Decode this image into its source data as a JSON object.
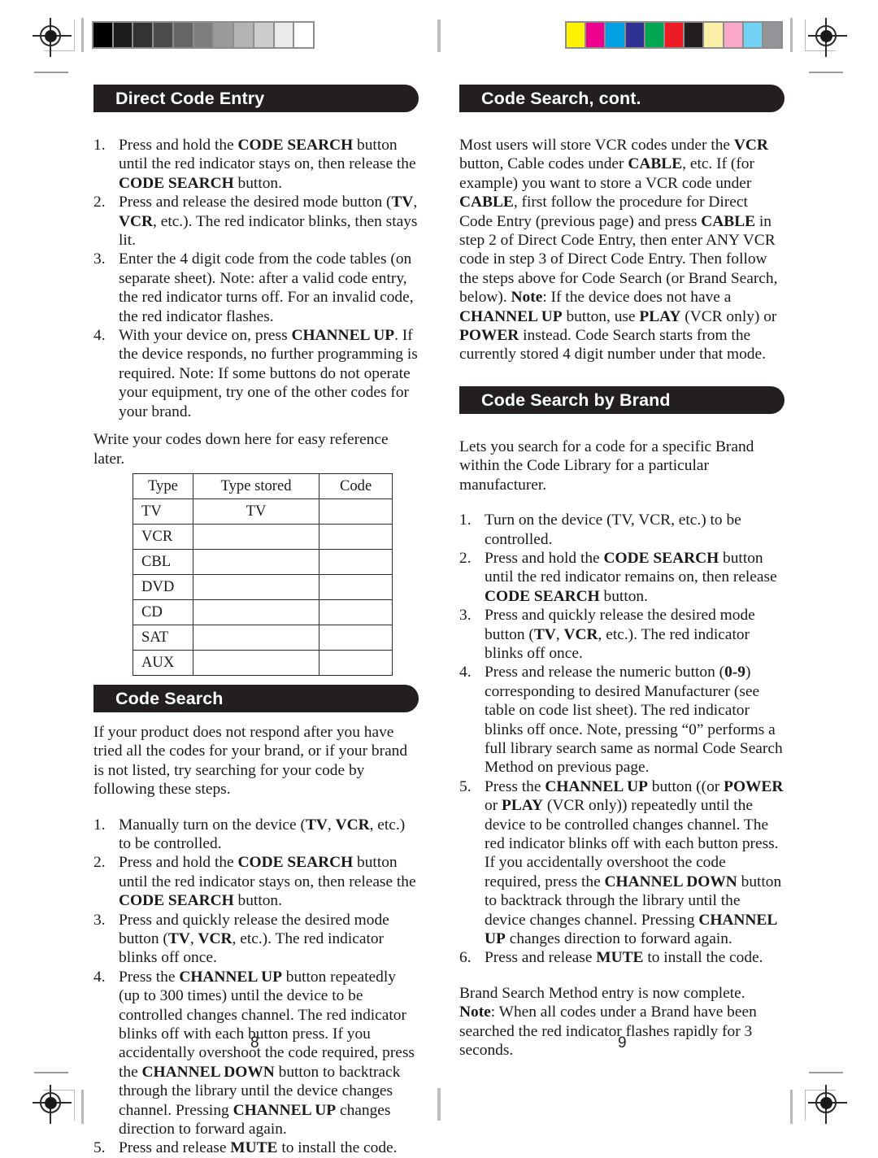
{
  "print_marks": {
    "grayscale_bar": {
      "name": "grayscale-step-wedge",
      "patches": [
        "#000000",
        "#1c1c1c",
        "#333333",
        "#4c4c4c",
        "#656565",
        "#7e7e7e",
        "#9b9b9b",
        "#b5b5b5",
        "#cccccc",
        "#eaeaea",
        "#ffffff"
      ]
    },
    "color_bar": {
      "name": "process-color-bar",
      "patches": [
        "#fff200",
        "#ec008c",
        "#00a0e3",
        "#2e3192",
        "#00a651",
        "#ed1c24",
        "#231f20",
        "#fbf0a8",
        "#f9a8c8",
        "#72d2f4",
        "#939598"
      ]
    }
  },
  "left_page": {
    "page_number": "8",
    "sections": [
      {
        "id": "direct-code-entry",
        "header": "Direct Code Entry",
        "steps": [
          {
            "num": "1.",
            "parts": [
              {
                "t": "Press and hold the "
              },
              {
                "t": "CODE SEARCH",
                "b": true
              },
              {
                "t": " button until the red indicator stays on, then release the "
              },
              {
                "t": "CODE SEARCH",
                "b": true
              },
              {
                "t": " button."
              }
            ]
          },
          {
            "num": "2.",
            "parts": [
              {
                "t": "Press and release the desired mode button ("
              },
              {
                "t": "TV",
                "b": true
              },
              {
                "t": ", "
              },
              {
                "t": "VCR",
                "b": true
              },
              {
                "t": ", etc.). The red indicator blinks, then stays lit."
              }
            ]
          },
          {
            "num": "3.",
            "parts": [
              {
                "t": "Enter the 4 digit code from the code tables (on separate sheet). Note: after a valid code entry, the red indicator turns off.  For an invalid code, the red indicator flashes."
              }
            ]
          },
          {
            "num": "4.",
            "parts": [
              {
                "t": "With your device on, press "
              },
              {
                "t": "CHANNEL UP",
                "b": true
              },
              {
                "t": ". If the device responds, no further programming is required. Note: If some buttons do not operate your equipment, try one of the other codes for your brand."
              }
            ]
          }
        ],
        "table_intro": "Write your codes down here for easy reference later.",
        "table": {
          "headers": [
            "Type",
            "Type  stored",
            "Code"
          ],
          "rows": [
            {
              "type": "TV",
              "stored": "TV",
              "code": ""
            },
            {
              "type": "VCR",
              "stored": "",
              "code": ""
            },
            {
              "type": "CBL",
              "stored": "",
              "code": ""
            },
            {
              "type": "DVD",
              "stored": "",
              "code": ""
            },
            {
              "type": "CD",
              "stored": "",
              "code": ""
            },
            {
              "type": "SAT",
              "stored": "",
              "code": ""
            },
            {
              "type": "AUX",
              "stored": "",
              "code": ""
            }
          ]
        }
      },
      {
        "id": "code-search",
        "header": "Code Search",
        "intro": "If your product does not respond after you have tried all the codes for your brand, or if your brand is not listed, try searching for your code by following these steps.",
        "steps": [
          {
            "num": "1.",
            "parts": [
              {
                "t": "Manually turn on the device ("
              },
              {
                "t": "TV",
                "b": true
              },
              {
                "t": ", "
              },
              {
                "t": "VCR",
                "b": true
              },
              {
                "t": ", etc.) to be controlled."
              }
            ]
          },
          {
            "num": "2.",
            "parts": [
              {
                "t": "Press and hold the "
              },
              {
                "t": "CODE SEARCH",
                "b": true
              },
              {
                "t": " button until the red indicator stays on, then release the "
              },
              {
                "t": "CODE SEARCH",
                "b": true
              },
              {
                "t": " button."
              }
            ]
          },
          {
            "num": "3.",
            "parts": [
              {
                "t": "Press and quickly release the desired mode button ("
              },
              {
                "t": "TV",
                "b": true
              },
              {
                "t": ", "
              },
              {
                "t": "VCR",
                "b": true
              },
              {
                "t": ", etc.). The red indicator blinks off once."
              }
            ]
          },
          {
            "num": "4.",
            "parts": [
              {
                "t": "Press the "
              },
              {
                "t": "CHANNEL UP",
                "b": true
              },
              {
                "t": " button repeatedly (up to 300 times) until the device to be controlled changes channel. The red indicator blinks off with each button press.  If you accidentally overshoot the code required, press the "
              },
              {
                "t": "CHANNEL DOWN",
                "b": true
              },
              {
                "t": " button to backtrack through the library until the device changes channel. Pressing "
              },
              {
                "t": "CHANNEL UP",
                "b": true
              },
              {
                "t": " changes direction to forward again."
              }
            ]
          },
          {
            "num": "5.",
            "parts": [
              {
                "t": "Press and release "
              },
              {
                "t": "MUTE",
                "b": true
              },
              {
                "t": " to install the code."
              }
            ]
          }
        ]
      }
    ]
  },
  "right_page": {
    "page_number": "9",
    "sections": [
      {
        "id": "code-search-cont",
        "header": "Code Search, cont.",
        "body": [
          {
            "t": "Most users will store VCR codes under the "
          },
          {
            "t": "VCR",
            "b": true
          },
          {
            "t": " button, Cable codes under "
          },
          {
            "t": "CABLE",
            "b": true
          },
          {
            "t": ", etc. If (for example) you want to store a VCR code under "
          },
          {
            "t": "CABLE",
            "b": true
          },
          {
            "t": ", first follow the procedure for Direct Code Entry (previous page) and press "
          },
          {
            "t": "CABLE",
            "b": true
          },
          {
            "t": " in step 2 of Direct Code Entry, then enter ANY VCR code in step 3 of Direct Code Entry. Then follow the steps above for Code Search (or Brand Search, below). "
          },
          {
            "t": "Note",
            "b": true
          },
          {
            "t": ":  If the device does not have a "
          },
          {
            "t": "CHANNEL UP",
            "b": true
          },
          {
            "t": " button, use "
          },
          {
            "t": "PLAY",
            "b": true
          },
          {
            "t": " (VCR only) or "
          },
          {
            "t": "POWER",
            "b": true
          },
          {
            "t": " instead. Code Search starts from the currently stored 4 digit number under that mode."
          }
        ]
      },
      {
        "id": "code-search-by-brand",
        "header": "Code Search by Brand",
        "intro": "Lets you search for a code for a specific Brand within the Code Library for a particular manufacturer.",
        "steps": [
          {
            "num": "1.",
            "parts": [
              {
                "t": "Turn on the device (TV, VCR, etc.) to be controlled."
              }
            ]
          },
          {
            "num": "2.",
            "parts": [
              {
                "t": "Press and hold the "
              },
              {
                "t": "CODE SEARCH",
                "b": true
              },
              {
                "t": " button until the red indicator remains on, then release "
              },
              {
                "t": "CODE SEARCH",
                "b": true
              },
              {
                "t": " button."
              }
            ]
          },
          {
            "num": "3.",
            "parts": [
              {
                "t": "Press and quickly release the desired mode button ("
              },
              {
                "t": "TV",
                "b": true
              },
              {
                "t": ", "
              },
              {
                "t": "VCR",
                "b": true
              },
              {
                "t": ", etc.). The red indicator blinks off once."
              }
            ]
          },
          {
            "num": "4.",
            "parts": [
              {
                "t": "Press and release the numeric button ("
              },
              {
                "t": "0-9",
                "b": true
              },
              {
                "t": ") corresponding to desired Manufacturer (see table on code list sheet).  The red indicator blinks off once. Note, pressing “0” performs a full library search same as normal Code Search Method on previous page."
              }
            ]
          },
          {
            "num": "5.",
            "parts": [
              {
                "t": "Press the "
              },
              {
                "t": "CHANNEL UP",
                "b": true
              },
              {
                "t": " button ((or "
              },
              {
                "t": "POWER",
                "b": true
              },
              {
                "t": " or "
              },
              {
                "t": "PLAY",
                "b": true
              },
              {
                "t": " (VCR only)) repeatedly until the device to be controlled changes channel. The red indicator blinks off with each button press. If you accidentally overshoot the code required, press the "
              },
              {
                "t": "CHANNEL DOWN",
                "b": true
              },
              {
                "t": " button to backtrack through the library until the device changes channel. Pressing "
              },
              {
                "t": "CHANNEL UP",
                "b": true
              },
              {
                "t": " changes direction to forward again."
              }
            ]
          },
          {
            "num": "6.",
            "parts": [
              {
                "t": "Press and release "
              },
              {
                "t": "MUTE",
                "b": true
              },
              {
                "t": " to install the code."
              }
            ]
          }
        ],
        "closing": [
          {
            "t": "Brand Search Method entry is now complete."
          },
          {
            "t": "\n"
          },
          {
            "t": "Note",
            "b": true
          },
          {
            "t": ": When all codes under a Brand have been searched the red indicator flashes rapidly for 3 seconds."
          }
        ]
      }
    ]
  }
}
